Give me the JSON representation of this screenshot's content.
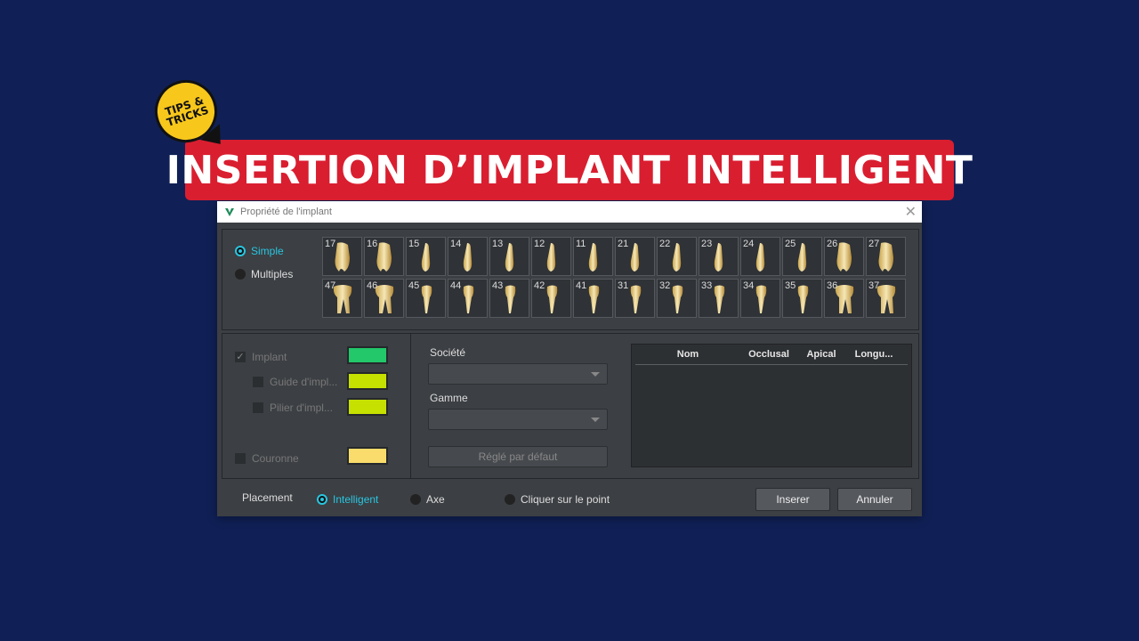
{
  "badge": {
    "line1": "TIPS &",
    "line2": "TRICKS"
  },
  "banner": {
    "title": "INSERTION D’IMPLANT INTELLIGENT"
  },
  "dialog": {
    "title": "Propriété de l'implant",
    "close": "✕"
  },
  "mode": {
    "simple": "Simple",
    "multiples": "Multiples",
    "selected": "Simple"
  },
  "teeth": {
    "upper": [
      "17",
      "16",
      "15",
      "14",
      "13",
      "12",
      "11",
      "21",
      "22",
      "23",
      "24",
      "25",
      "26",
      "27"
    ],
    "lower": [
      "47",
      "46",
      "45",
      "44",
      "43",
      "42",
      "41",
      "31",
      "32",
      "33",
      "34",
      "35",
      "36",
      "37"
    ]
  },
  "options": {
    "implant": "Implant",
    "guide": "Guide d'impl...",
    "pilier": "Pilier d'impl...",
    "couronne": "Couronne",
    "colors": {
      "implant": "#22c86a",
      "guide": "#c6e000",
      "pilier": "#c6e000",
      "couronne": "#f9dc6b"
    }
  },
  "form": {
    "societe": "Société",
    "gamme": "Gamme",
    "default_button": "Réglé par défaut"
  },
  "table": {
    "columns": [
      "Nom",
      "Occlusal",
      "Apical",
      "Longu..."
    ]
  },
  "placement": {
    "label": "Placement",
    "intelligent": "Intelligent",
    "axe": "Axe",
    "point": "Cliquer sur le point",
    "selected": "Intelligent"
  },
  "buttons": {
    "insert": "Inserer",
    "cancel": "Annuler"
  },
  "colors": {
    "background": "#102056",
    "banner": "#d91e30",
    "badge": "#f7c71c",
    "accent": "#29c5e0"
  }
}
